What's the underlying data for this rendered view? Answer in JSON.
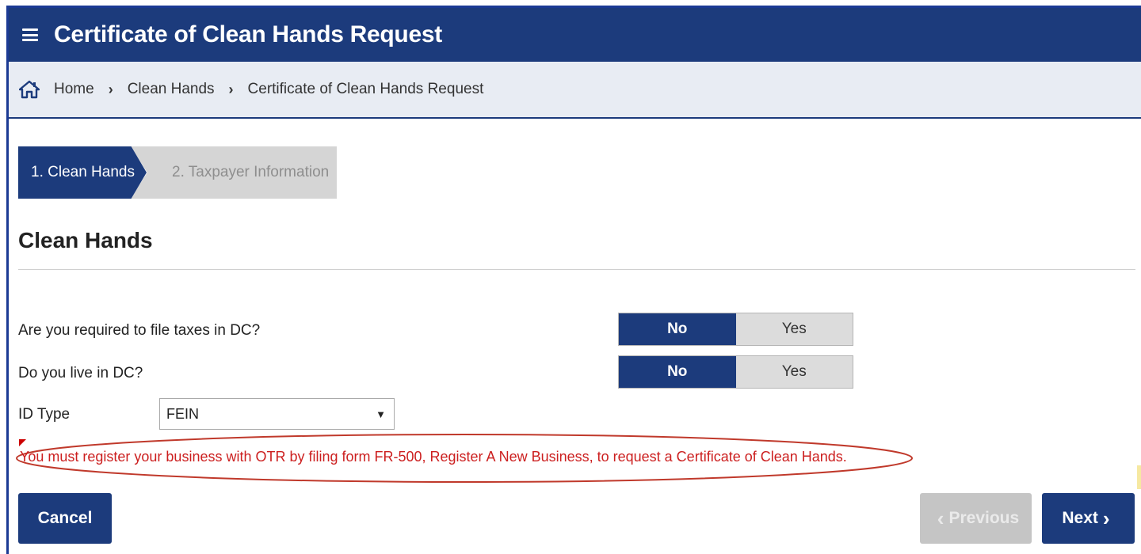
{
  "header": {
    "title": "Certificate of Clean Hands Request"
  },
  "breadcrumb": {
    "items": [
      "Home",
      "Clean Hands",
      "Certificate of Clean Hands Request"
    ],
    "separator": "›"
  },
  "steps": [
    {
      "label": "1. Clean Hands",
      "state": "active"
    },
    {
      "label": "2. Taxpayer Information",
      "state": "inactive"
    }
  ],
  "section": {
    "title": "Clean Hands"
  },
  "questions": {
    "file_taxes": {
      "label": "Are you required to file taxes in DC?",
      "options": [
        "No",
        "Yes"
      ],
      "selected": "No"
    },
    "live_dc": {
      "label": "Do you live in DC?",
      "options": [
        "No",
        "Yes"
      ],
      "selected": "No"
    }
  },
  "id_type": {
    "label": "ID Type",
    "value": "FEIN"
  },
  "error": {
    "message": "You must register your business with OTR by filing form FR-500, Register A New Business, to request a Certificate of Clean Hands."
  },
  "buttons": {
    "cancel": "Cancel",
    "previous": "Previous",
    "next": "Next"
  },
  "colors": {
    "primary": "#1c3b7c",
    "breadcrumb_bg": "#e8ecf3",
    "error": "#cc1f1f",
    "disabled": "#c5c5c5"
  }
}
